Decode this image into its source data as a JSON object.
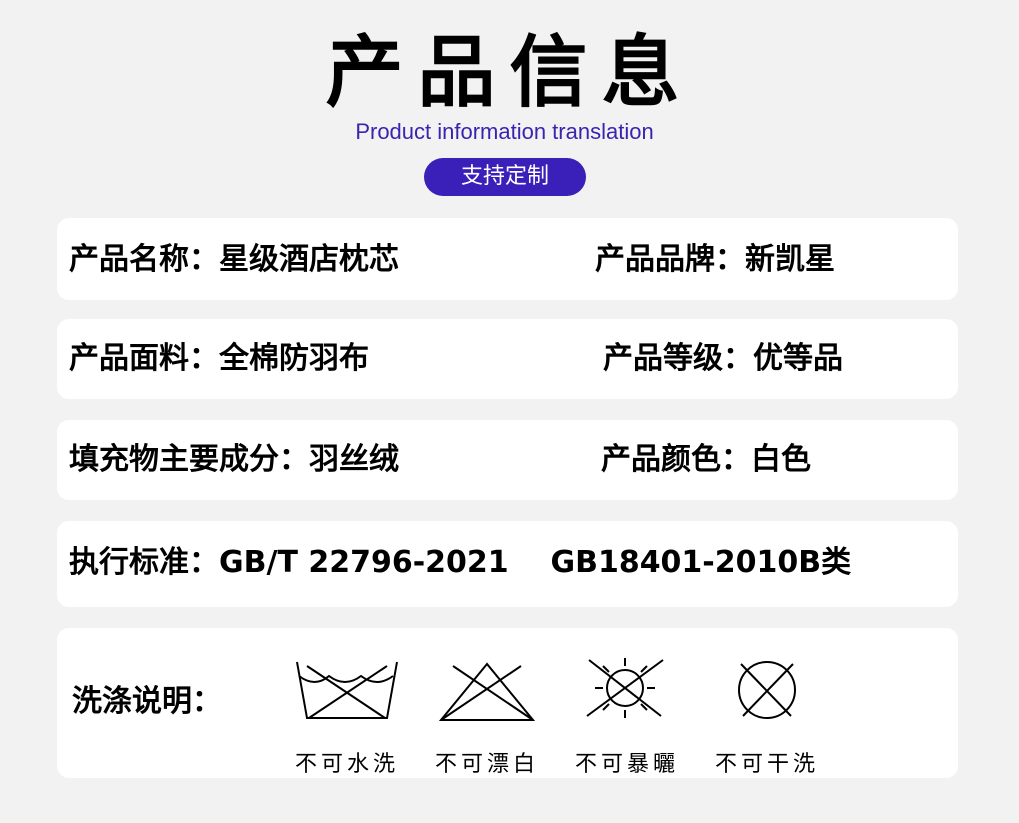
{
  "header": {
    "title": "产品信息",
    "subtitle": "Product information translation",
    "badge": "支持定制"
  },
  "rows": {
    "name": "产品名称：星级酒店枕芯",
    "brand": "产品品牌：新凯星",
    "fabric": "产品面料：全棉防羽布",
    "grade": "产品等级：优等品",
    "filling": "填充物主要成分：羽丝绒",
    "color": "产品颜色：白色",
    "standard": "执行标准：GB/T 22796-2021    GB18401-2010B类"
  },
  "care": {
    "label": "洗涤说明：",
    "items": [
      {
        "icon": "no-wash-icon",
        "label": "不可水洗"
      },
      {
        "icon": "no-bleach-icon",
        "label": "不可漂白"
      },
      {
        "icon": "no-sun-dry-icon",
        "label": "不可暴曬"
      },
      {
        "icon": "no-dry-clean-icon",
        "label": "不可干洗"
      }
    ]
  },
  "colors": {
    "background": "#f2f2f2",
    "accent": "#3a1fb8",
    "card": "#ffffff"
  }
}
